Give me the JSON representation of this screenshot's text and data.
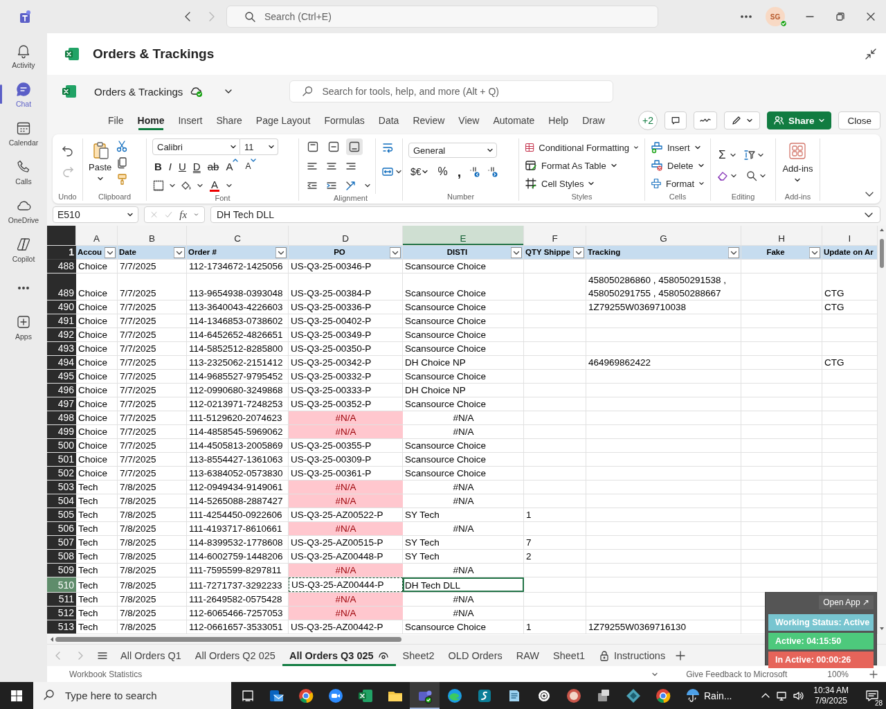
{
  "teams": {
    "search_placeholder": "Search (Ctrl+E)",
    "avatar_initials": "SG"
  },
  "rail": [
    {
      "label": "Activity",
      "kind": "bell",
      "selected": false
    },
    {
      "label": "Chat",
      "kind": "chat",
      "selected": true
    },
    {
      "label": "Calendar",
      "kind": "calendar",
      "selected": false
    },
    {
      "label": "Calls",
      "kind": "phone",
      "selected": false
    },
    {
      "label": "OneDrive",
      "kind": "cloud",
      "selected": false
    },
    {
      "label": "Copilot",
      "kind": "copilot",
      "selected": false
    },
    {
      "kind": "more",
      "selected": false
    },
    {
      "label": "Apps",
      "kind": "apps",
      "selected": false
    }
  ],
  "header": {
    "title": "Orders & Trackings"
  },
  "workbook": {
    "file_name": "Orders & Trackings",
    "search_placeholder": "Search for tools, help, and more (Alt + Q)"
  },
  "menu_tabs": [
    {
      "label": "File",
      "selected": false
    },
    {
      "label": "Home",
      "selected": true
    },
    {
      "label": "Insert",
      "selected": false
    },
    {
      "label": "Share",
      "selected": false
    },
    {
      "label": "Page Layout",
      "selected": false
    },
    {
      "label": "Formulas",
      "selected": false
    },
    {
      "label": "Data",
      "selected": false
    },
    {
      "label": "Review",
      "selected": false
    },
    {
      "label": "View",
      "selected": false
    },
    {
      "label": "Automate",
      "selected": false
    },
    {
      "label": "Help",
      "selected": false
    },
    {
      "label": "Draw",
      "selected": false
    }
  ],
  "toolbar": {
    "collaborators": "+2",
    "share": "Share",
    "close": "Close"
  },
  "ribbon": {
    "undo_label": "Undo",
    "paste": "Paste",
    "clipboard_label": "Clipboard",
    "font_name": "Calibri",
    "font_size": "11",
    "font_buttons": [
      {
        "glyph": "B",
        "kind": "bold"
      },
      {
        "glyph": "I",
        "kind": "italic"
      },
      {
        "glyph": "U",
        "kind": "underline"
      },
      {
        "glyph": "D",
        "kind": "double"
      },
      {
        "glyph": "ab",
        "kind": "strike"
      },
      {
        "glyph": "A",
        "kind": "grow"
      },
      {
        "glyph": "A",
        "kind": "shrink"
      }
    ],
    "font_color": "A",
    "font_label": "Font",
    "vertical_align": [
      {
        "kind": "top",
        "selected": false
      },
      {
        "kind": "middle",
        "selected": false
      },
      {
        "kind": "bottom",
        "selected": true
      }
    ],
    "alignment_label": "Alignment",
    "number_format": "General",
    "currency": "$€",
    "percent": "%",
    "comma": ",",
    "number_label": "Number",
    "styles": [
      "Conditional Formatting",
      "Format As Table",
      "Cell Styles"
    ],
    "styles_label": "Styles",
    "cells": [
      "Insert",
      "Delete",
      "Format"
    ],
    "cells_label": "Cells",
    "sum": "Σ",
    "editing_label": "Editing",
    "addins": "Add-ins",
    "addins_label": "Add-ins"
  },
  "formula_bar": {
    "name_box": "E510",
    "fx": "fx",
    "formula": "DH Tech DLL"
  },
  "sheet": {
    "header_row": "1",
    "columns": [
      {
        "letter": "A",
        "heading": "Accou",
        "selected": false
      },
      {
        "letter": "B",
        "heading": "Date",
        "selected": false
      },
      {
        "letter": "C",
        "heading": "Order #",
        "selected": false
      },
      {
        "letter": "D",
        "heading": "PO",
        "selected": false
      },
      {
        "letter": "E",
        "heading": "DISTI",
        "selected": true
      },
      {
        "letter": "F",
        "heading": "QTY Shippe",
        "selected": false
      },
      {
        "letter": "G",
        "heading": "Tracking",
        "selected": false
      },
      {
        "letter": "H",
        "heading": "Fake",
        "selected": false
      },
      {
        "letter": "I",
        "heading": "Update on Ar",
        "selected": false
      }
    ],
    "rows": [
      {
        "row": "488",
        "selected": false,
        "error": false,
        "copied": false,
        "a": "Choice",
        "b": "7/7/2025",
        "c": "112-1734672-1425056",
        "d": "US-Q3-25-00346-P",
        "e": "Scansource Choice"
      },
      {
        "row": "489",
        "selected": false,
        "error": false,
        "copied": false,
        "a": "Choice",
        "b": "7/7/2025",
        "c": "113-9654938-0393048",
        "d": "US-Q3-25-00384-P",
        "e": "Scansource Choice",
        "g": "458050286860 , 458050291538 , 458050291755 , 458050288667",
        "i": "CTG"
      },
      {
        "row": "490",
        "selected": false,
        "error": false,
        "copied": false,
        "a": "Choice",
        "b": "7/7/2025",
        "c": "113-3640043-4226603",
        "d": "US-Q3-25-00336-P",
        "e": "Scansource Choice",
        "g": "1Z79255W0369710038",
        "i": "CTG"
      },
      {
        "row": "491",
        "selected": false,
        "error": false,
        "copied": false,
        "a": "Choice",
        "b": "7/7/2025",
        "c": "114-1346853-0738602",
        "d": "US-Q3-25-00402-P",
        "e": "Scansource Choice"
      },
      {
        "row": "492",
        "selected": false,
        "error": false,
        "copied": false,
        "a": "Choice",
        "b": "7/7/2025",
        "c": "114-6452652-4826651",
        "d": "US-Q3-25-00349-P",
        "e": "Scansource Choice"
      },
      {
        "row": "493",
        "selected": false,
        "error": false,
        "copied": false,
        "a": "Choice",
        "b": "7/7/2025",
        "c": "114-5852512-8285800",
        "d": "US-Q3-25-00350-P",
        "e": "Scansource Choice"
      },
      {
        "row": "494",
        "selected": false,
        "error": false,
        "copied": false,
        "a": "Choice",
        "b": "7/7/2025",
        "c": "113-2325062-2151412",
        "d": "US-Q3-25-00342-P",
        "e": "DH Choice NP",
        "g": "464969862422",
        "i": "CTG"
      },
      {
        "row": "495",
        "selected": false,
        "error": false,
        "copied": false,
        "a": "Choice",
        "b": "7/7/2025",
        "c": "114-9685527-9795452",
        "d": "US-Q3-25-00332-P",
        "e": "Scansource Choice"
      },
      {
        "row": "496",
        "selected": false,
        "error": false,
        "copied": false,
        "a": "Choice",
        "b": "7/7/2025",
        "c": "112-0990680-3249868",
        "d": "US-Q3-25-00333-P",
        "e": "DH Choice NP"
      },
      {
        "row": "497",
        "selected": false,
        "error": false,
        "copied": false,
        "a": "Choice",
        "b": "7/7/2025",
        "c": "112-0213971-7248253",
        "d": "US-Q3-25-00352-P",
        "e": "Scansource Choice"
      },
      {
        "row": "498",
        "selected": false,
        "error": true,
        "copied": false,
        "a": "Choice",
        "b": "7/7/2025",
        "c": "111-5129620-2074623",
        "d": "#N/A",
        "e": "#N/A"
      },
      {
        "row": "499",
        "selected": false,
        "error": true,
        "copied": false,
        "a": "Choice",
        "b": "7/7/2025",
        "c": "114-4858545-5969062",
        "d": "#N/A",
        "e": "#N/A"
      },
      {
        "row": "500",
        "selected": false,
        "error": false,
        "copied": false,
        "a": "Choice",
        "b": "7/7/2025",
        "c": "114-4505813-2005869",
        "d": "US-Q3-25-00355-P",
        "e": "Scansource Choice"
      },
      {
        "row": "501",
        "selected": false,
        "error": false,
        "copied": false,
        "a": "Choice",
        "b": "7/7/2025",
        "c": "113-8554427-1361063",
        "d": "US-Q3-25-00309-P",
        "e": "Scansource Choice"
      },
      {
        "row": "502",
        "selected": false,
        "error": false,
        "copied": false,
        "a": "Choice",
        "b": "7/7/2025",
        "c": "113-6384052-0573830",
        "d": "US-Q3-25-00361-P",
        "e": "Scansource Choice"
      },
      {
        "row": "503",
        "selected": false,
        "error": true,
        "copied": false,
        "a": "Tech",
        "b": "7/8/2025",
        "c": "112-0949434-9149061",
        "d": "#N/A",
        "e": "#N/A"
      },
      {
        "row": "504",
        "selected": false,
        "error": true,
        "copied": false,
        "a": "Tech",
        "b": "7/8/2025",
        "c": "114-5265088-2887427",
        "d": "#N/A",
        "e": "#N/A"
      },
      {
        "row": "505",
        "selected": false,
        "error": false,
        "copied": false,
        "a": "Tech",
        "b": "7/8/2025",
        "c": "111-4254450-0922606",
        "d": "US-Q3-25-AZ00522-P",
        "e": "SY Tech",
        "f": "1"
      },
      {
        "row": "506",
        "selected": false,
        "error": true,
        "copied": false,
        "a": "Tech",
        "b": "7/8/2025",
        "c": "111-4193717-8610661",
        "d": "#N/A",
        "e": "#N/A"
      },
      {
        "row": "507",
        "selected": false,
        "error": false,
        "copied": false,
        "a": "Tech",
        "b": "7/8/2025",
        "c": "114-8399532-1778608",
        "d": "US-Q3-25-AZ00515-P",
        "e": "SY Tech",
        "f": "7"
      },
      {
        "row": "508",
        "selected": false,
        "error": false,
        "copied": false,
        "a": "Tech",
        "b": "7/8/2025",
        "c": "114-6002759-1448206",
        "d": "US-Q3-25-AZ00448-P",
        "e": "SY Tech",
        "f": "2"
      },
      {
        "row": "509",
        "selected": false,
        "error": true,
        "copied": false,
        "a": "Tech",
        "b": "7/8/2025",
        "c": "111-7595599-8297811",
        "d": "#N/A",
        "e": "#N/A"
      },
      {
        "row": "510",
        "selected": true,
        "error": false,
        "copied": true,
        "a": "Tech",
        "b": "7/8/2025",
        "c": "111-7271737-3292233",
        "d": "US-Q3-25-AZ00444-P",
        "e": "DH Tech DLL"
      },
      {
        "row": "511",
        "selected": false,
        "error": true,
        "copied": false,
        "a": "Tech",
        "b": "7/8/2025",
        "c": "111-2649582-0575428",
        "d": "#N/A",
        "e": "#N/A"
      },
      {
        "row": "512",
        "selected": false,
        "error": true,
        "copied": false,
        "a": "Tech",
        "b": "7/8/2025",
        "c": "112-6065466-7257053",
        "d": "#N/A",
        "e": "#N/A"
      },
      {
        "row": "513",
        "selected": false,
        "error": false,
        "copied": false,
        "a": "Tech",
        "b": "7/8/2025",
        "c": "112-0661657-3533051",
        "d": "US-Q3-25-AZ00442-P",
        "e": "Scansource Choice",
        "f": "1",
        "g": "1Z79255W0369716130"
      }
    ]
  },
  "sheet_tabs": [
    {
      "label": "All Orders Q1",
      "selected": false,
      "kind": "plain"
    },
    {
      "label": "All Orders Q2 025",
      "selected": false,
      "kind": "plain"
    },
    {
      "label": "All Orders Q3 025",
      "selected": true,
      "kind": "watched"
    },
    {
      "label": "Sheet2",
      "selected": false,
      "kind": "plain"
    },
    {
      "label": "OLD Orders",
      "selected": false,
      "kind": "plain"
    },
    {
      "label": "RAW",
      "selected": false,
      "kind": "plain"
    },
    {
      "label": "Sheet1",
      "selected": false,
      "kind": "plain"
    },
    {
      "label": "Instructions",
      "selected": false,
      "kind": "locked"
    }
  ],
  "status_bar": {
    "statistics": "Workbook Statistics",
    "feedback": "Give Feedback to Microsoft",
    "zoom": "100%"
  },
  "status_widget": {
    "open_button": "Open App ↗",
    "items": [
      {
        "text": "Working Status: Active",
        "color": "#78c5d0"
      },
      {
        "text": "Active: 04:15:50",
        "color": "#4dc97c"
      },
      {
        "text": "In Active: 00:00:26",
        "color": "#e6645a"
      }
    ]
  },
  "taskbar": {
    "search_placeholder": "Type here to search",
    "apps": [
      {
        "kind": "mail",
        "active": false
      },
      {
        "kind": "chrome",
        "active": false
      },
      {
        "kind": "video",
        "active": false
      },
      {
        "kind": "sheet",
        "active": false
      },
      {
        "kind": "folder",
        "active": false
      },
      {
        "kind": "chat",
        "active": true
      },
      {
        "kind": "edge",
        "active": false
      },
      {
        "kind": "swirl",
        "active": false
      },
      {
        "kind": "notepad",
        "active": false
      },
      {
        "kind": "gear",
        "active": false
      },
      {
        "kind": "badge",
        "active": false
      },
      {
        "kind": "media",
        "active": false
      },
      {
        "kind": "diamond",
        "active": false
      },
      {
        "kind": "chrome",
        "active": false
      }
    ],
    "weather": "Rain...",
    "time": "10:34 AM",
    "date": "7/9/2025",
    "notifications": "28"
  }
}
